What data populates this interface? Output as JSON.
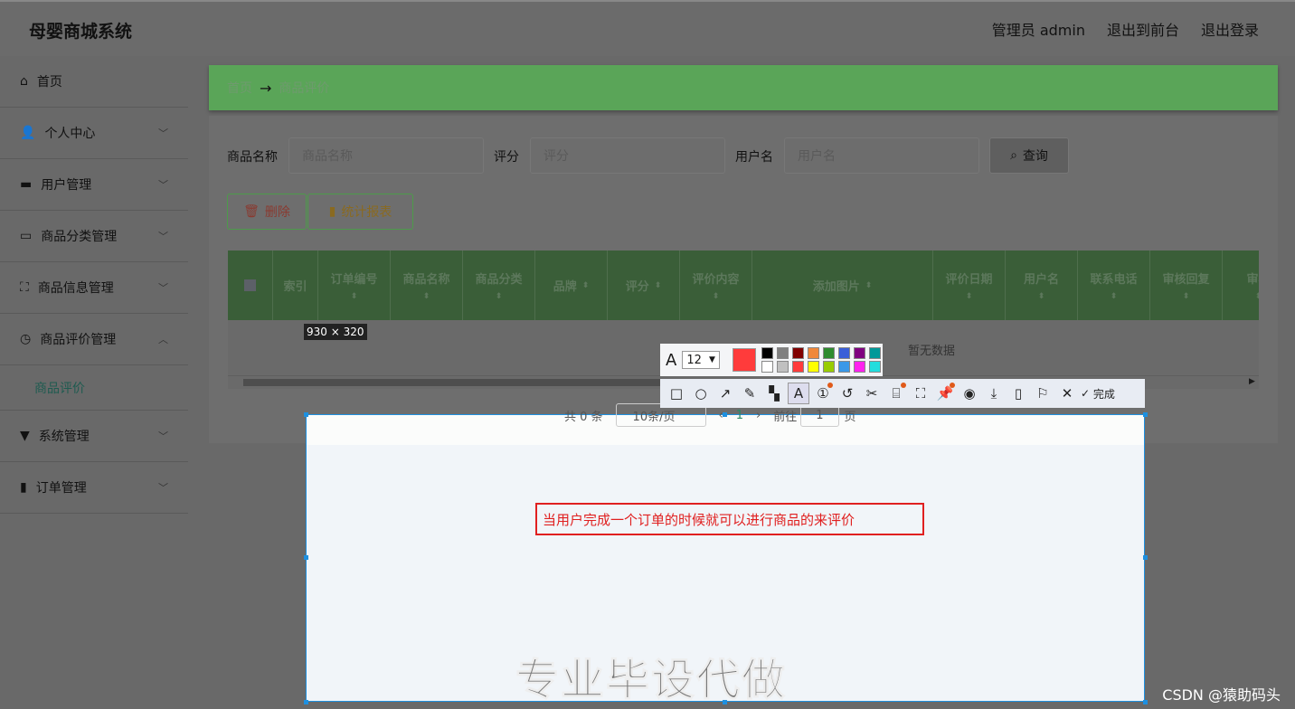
{
  "header": {
    "title": "母婴商城系统",
    "nav": [
      "管理员 admin",
      "退出到前台",
      "退出登录"
    ]
  },
  "sidebar": {
    "items": [
      {
        "label": "首页",
        "icon": "home-icon"
      },
      {
        "label": "个人中心",
        "icon": "user-icon"
      },
      {
        "label": "用户管理",
        "icon": "briefcase-icon"
      },
      {
        "label": "商品分类管理",
        "icon": "chat-icon"
      },
      {
        "label": "商品信息管理",
        "icon": "frame-icon"
      },
      {
        "label": "商品评价管理",
        "icon": "compass-icon",
        "expanded": true
      },
      {
        "label": "系统管理",
        "icon": "monitor-icon"
      },
      {
        "label": "订单管理",
        "icon": "chart-icon"
      }
    ],
    "sub": "商品评价"
  },
  "breadcrumb": {
    "home": "首页",
    "arrow": "→",
    "current": "商品评价"
  },
  "search": {
    "name_label": "商品名称",
    "name_placeholder": "商品名称",
    "score_label": "评分",
    "score_placeholder": "评分",
    "user_label": "用户名",
    "user_placeholder": "用户名",
    "query": "查询"
  },
  "actions": {
    "delete": "删除",
    "report": "统计报表"
  },
  "table": {
    "columns": [
      "索引",
      "订单编号",
      "商品名称",
      "商品分类",
      "品牌",
      "评分",
      "评价内容",
      "添加图片",
      "评价日期",
      "用户名",
      "联系电话",
      "审核回复",
      "审核"
    ],
    "empty": "暂无数据"
  },
  "pagination": {
    "total": "共 0 条",
    "page_size": "10条/页",
    "current": "1",
    "goto": "前往",
    "goto_value": "1",
    "page_unit": "页"
  },
  "screenshot_tool": {
    "size": "930 × 320",
    "font_size": "12",
    "color": "#ff3b3b",
    "palette": [
      "#000000",
      "#808080",
      "#800000",
      "#f0883a",
      "#2e8b2e",
      "#3a5fd8",
      "#800080",
      "#009999",
      "#ffffff",
      "#c0c0c0",
      "#ff3b3b",
      "#ffff00",
      "#99cc00",
      "#3a98e8",
      "#ff22ee",
      "#22dddd"
    ],
    "done": "完成",
    "annotation_text": "当用户完成一个订单的时候就可以进行商品的来评价"
  },
  "watermark": "专业毕设代做",
  "credit": "CSDN @猿助码头"
}
